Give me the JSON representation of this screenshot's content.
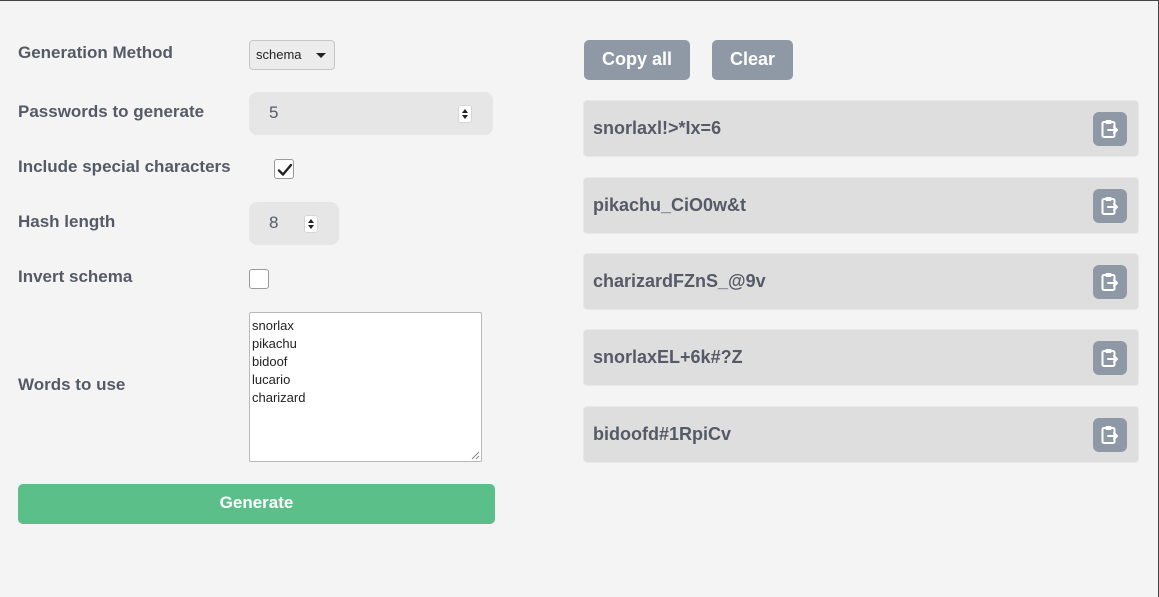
{
  "form": {
    "generation_method": {
      "label": "Generation Method",
      "value": "schema"
    },
    "passwords_to_generate": {
      "label": "Passwords to generate",
      "value": "5"
    },
    "include_special": {
      "label": "Include special characters",
      "checked": true
    },
    "hash_length": {
      "label": "Hash length",
      "value": "8"
    },
    "invert_schema": {
      "label": "Invert schema",
      "checked": false
    },
    "words": {
      "label": "Words to use",
      "list": [
        "snorlax",
        "pikachu",
        "bidoof",
        "lucario",
        "charizard"
      ]
    },
    "generate_label": "Generate"
  },
  "actions": {
    "copy_all_label": "Copy all",
    "clear_label": "Clear"
  },
  "passwords": [
    "snorlaxl!>*Ix=6",
    "pikachu_CiO0w&t",
    "charizardFZnS_@9v",
    "snorlaxEL+6k#?Z",
    "bidoofd#1RpiCv"
  ],
  "icons": {
    "copy": "clipboard-copy-icon",
    "checkmark": "checkmark-icon",
    "caret": "chevron-down-icon"
  },
  "colors": {
    "background": "#f4f4f4",
    "label_text": "#555b66",
    "generate_button": "#5bbf89",
    "secondary_button": "#8f98a5",
    "password_row": "#dedede"
  }
}
